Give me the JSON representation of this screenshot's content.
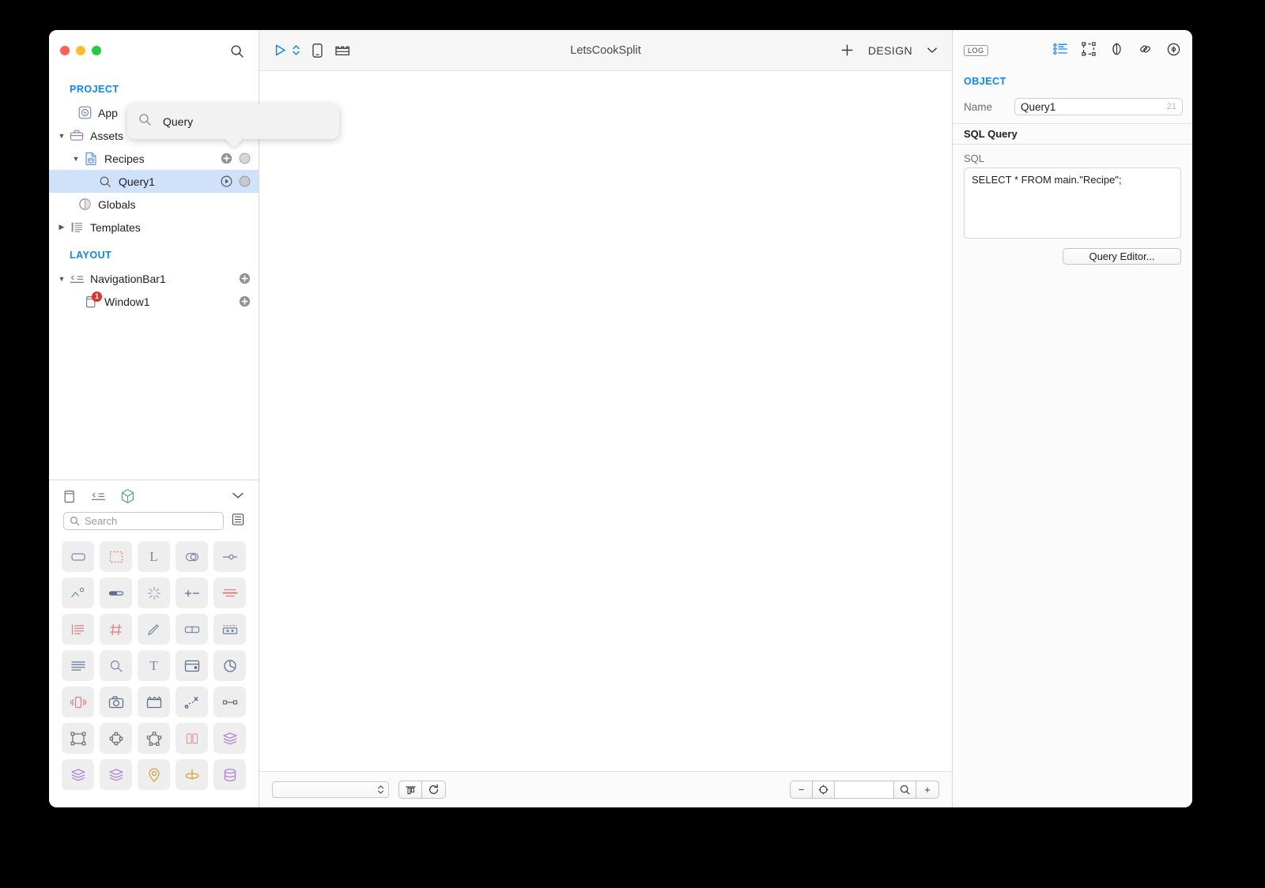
{
  "window": {
    "title": "LetsCookSplit",
    "traffic_lights": [
      "close",
      "minimize",
      "zoom"
    ]
  },
  "sidebar": {
    "search_icon": "search-icon",
    "sections": [
      {
        "label": "PROJECT",
        "items": [
          {
            "label": "App",
            "icon": "app-icon",
            "indent": 0,
            "disclosure": "",
            "selected": false,
            "actions": []
          },
          {
            "label": "Assets",
            "icon": "briefcase-icon",
            "indent": 0,
            "disclosure": "▼",
            "selected": false,
            "actions": []
          },
          {
            "label": "Recipes",
            "icon": "database-file-icon",
            "indent": 1,
            "disclosure": "▼",
            "selected": false,
            "actions": [
              "plus-circle",
              "gray-circle"
            ]
          },
          {
            "label": "Query1",
            "icon": "query-icon",
            "indent": 2,
            "disclosure": "",
            "selected": true,
            "actions": [
              "play-circle",
              "gray-circle"
            ]
          },
          {
            "label": "Globals",
            "icon": "globals-icon",
            "indent": 0,
            "disclosure": "",
            "selected": false,
            "actions": []
          },
          {
            "label": "Templates",
            "icon": "templates-icon",
            "indent": 0,
            "disclosure": "▶",
            "selected": false,
            "actions": []
          }
        ]
      },
      {
        "label": "LAYOUT",
        "items": [
          {
            "label": "NavigationBar1",
            "icon": "navbar-icon",
            "indent": 0,
            "disclosure": "▼",
            "selected": false,
            "actions": [
              "plus-circle"
            ]
          },
          {
            "label": "Window1",
            "icon": "window-icon",
            "indent": 1,
            "disclosure": "",
            "selected": false,
            "actions": [
              "plus-circle"
            ],
            "badge": "1"
          }
        ]
      }
    ]
  },
  "popover": {
    "icon": "search-icon",
    "text": "Query"
  },
  "library": {
    "tabs": [
      "window-tab-icon",
      "navbar-tab-icon",
      "cube-tab-icon"
    ],
    "collapse_icon": "chevron-down-icon",
    "search_placeholder": "Search",
    "list_view_icon": "list-view-icon",
    "items": [
      {
        "name": "button-control",
        "glyph": "rect-rounded",
        "color": "#7a8ba8"
      },
      {
        "name": "canvas-control",
        "glyph": "dashed-rect",
        "color": "#d98080"
      },
      {
        "name": "label-control",
        "glyph": "L",
        "color": "#7a8ba8"
      },
      {
        "name": "switch-control",
        "glyph": "toggle",
        "color": "#7a8ba8"
      },
      {
        "name": "slider-control",
        "glyph": "slider",
        "color": "#6e7d95"
      },
      {
        "name": "imageviewer-control",
        "glyph": "picture",
        "color": "#7a8ba8"
      },
      {
        "name": "progressbar-control",
        "glyph": "progress",
        "color": "#5d6f8c"
      },
      {
        "name": "spinner-control",
        "glyph": "spinner",
        "color": "#9aa6bb"
      },
      {
        "name": "stepper-control",
        "glyph": "plusminus",
        "color": "#5d6f8c"
      },
      {
        "name": "separator-control",
        "glyph": "lines-center",
        "color": "#d98080"
      },
      {
        "name": "listbox-control",
        "glyph": "listbox",
        "color": "#d98080"
      },
      {
        "name": "grid-control",
        "glyph": "hash",
        "color": "#d98080"
      },
      {
        "name": "paint-control",
        "glyph": "brush",
        "color": "#7a8ba8"
      },
      {
        "name": "segment-control",
        "glyph": "two-box",
        "color": "#7a8ba8"
      },
      {
        "name": "toolbar-control",
        "glyph": "dotted-top",
        "color": "#6e7d95"
      },
      {
        "name": "textarea-control",
        "glyph": "text-lines",
        "color": "#7a8ba8"
      },
      {
        "name": "searchfield-control",
        "glyph": "magnifier",
        "color": "#7a8ba8"
      },
      {
        "name": "textfield-control",
        "glyph": "T",
        "color": "#7a8ba8"
      },
      {
        "name": "datepicker-control",
        "glyph": "calendar",
        "color": "#5d6f8c"
      },
      {
        "name": "chart-control",
        "glyph": "pie",
        "color": "#5d6f8c"
      },
      {
        "name": "haptics-control",
        "glyph": "vibrate",
        "color": "#d98080"
      },
      {
        "name": "camera-control",
        "glyph": "camera",
        "color": "#5d6f8c"
      },
      {
        "name": "movieplayer-control",
        "glyph": "clapper",
        "color": "#5d6f8c"
      },
      {
        "name": "motion-control",
        "glyph": "motion",
        "color": "#5d6f8c"
      },
      {
        "name": "joint-control",
        "glyph": "joint",
        "color": "#6e6e73"
      },
      {
        "name": "boundingbox-control",
        "glyph": "bbox",
        "color": "#6e6e73"
      },
      {
        "name": "circle-node-control",
        "glyph": "circle-nodes",
        "color": "#6e6e73"
      },
      {
        "name": "polygon-node-control",
        "glyph": "poly-nodes",
        "color": "#6e6e73"
      },
      {
        "name": "splitview-control",
        "glyph": "split-two",
        "color": "#e79a9a"
      },
      {
        "name": "layers-control",
        "glyph": "layers",
        "color": "#b07fd0"
      },
      {
        "name": "layers2-control",
        "glyph": "layers",
        "color": "#b07fd0"
      },
      {
        "name": "layers3-control",
        "glyph": "layers",
        "color": "#b07fd0"
      },
      {
        "name": "location-control",
        "glyph": "pin",
        "color": "#d0a23a"
      },
      {
        "name": "orbit-control",
        "glyph": "orbit",
        "color": "#d0a23a"
      },
      {
        "name": "database-control",
        "glyph": "cylinder",
        "color": "#b07fd0"
      }
    ]
  },
  "toolbar": {
    "run_icon": "play-icon",
    "run_menu_icon": "updown-chevron-icon",
    "device_icon": "device-icon",
    "layout_icon": "layout-icon",
    "add_icon": "plus-icon",
    "mode_label": "DESIGN",
    "mode_chevron_icon": "chevron-down-icon"
  },
  "bottombar": {
    "combo_value": "",
    "combo_stepper_icon": "updown-chevron-icon",
    "align_icon": "align-icon",
    "refresh_icon": "refresh-icon",
    "zoom_out_label": "−",
    "zoom_fit_icon": "target-icon",
    "zoom_value": "",
    "zoom_search_icon": "magnifier-icon",
    "zoom_in_label": "+"
  },
  "inspector": {
    "log_badge": "LOG",
    "icons": [
      "properties-list-icon",
      "layout-bounds-icon",
      "appearance-icon",
      "bindings-link-icon",
      "preview-eye-icon"
    ],
    "title": "OBJECT",
    "name_label": "Name",
    "name_value": "Query1",
    "name_count": "21",
    "group_title": "SQL Query",
    "sql_label": "SQL",
    "sql_value": "SELECT * FROM main.\"Recipe\";",
    "query_editor_button": "Query Editor..."
  },
  "colors": {
    "accent": "#0a84ff",
    "selection": "#cfe2f9",
    "badge_red": "#e0342b"
  }
}
